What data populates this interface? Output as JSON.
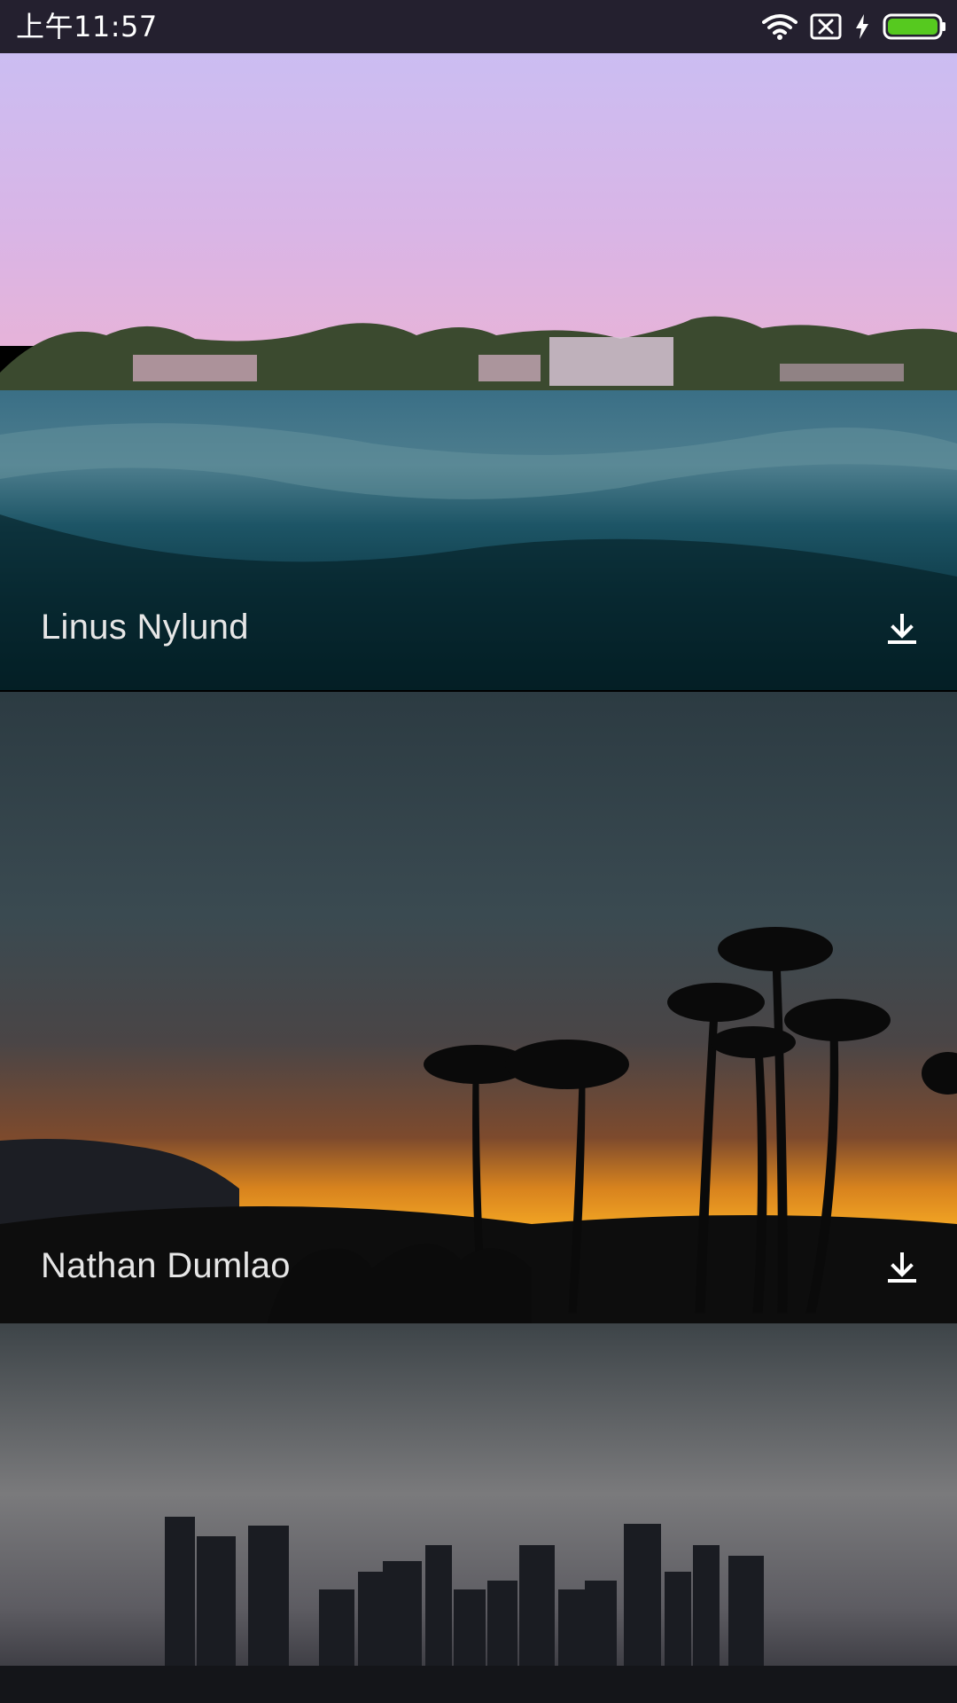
{
  "status_bar": {
    "time": "上午11:57",
    "icons": [
      "wifi-icon",
      "no-sim-icon",
      "charging-icon",
      "battery-icon"
    ],
    "battery_color": "#56c91f"
  },
  "feed": {
    "cards": [
      {
        "author": "Linus Nylund",
        "action_icon": "download-icon",
        "scene": "ocean-waterline-at-dusk"
      },
      {
        "author": "Nathan Dumlao",
        "action_icon": "download-icon",
        "scene": "palm-trees-at-sunset"
      },
      {
        "author": "",
        "action_icon": "",
        "scene": "city-skyline-at-night"
      }
    ]
  }
}
